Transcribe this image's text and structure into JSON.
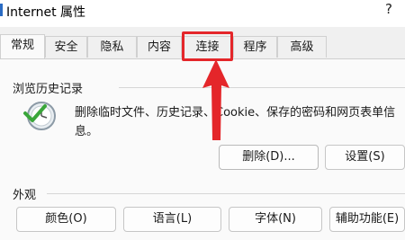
{
  "window": {
    "title": "Internet 属性",
    "help": "?"
  },
  "tabs": [
    {
      "label": "常规",
      "active": true
    },
    {
      "label": "安全"
    },
    {
      "label": "隐私"
    },
    {
      "label": "内容"
    },
    {
      "label": "连接",
      "highlighted": true
    },
    {
      "label": "程序"
    },
    {
      "label": "高级"
    }
  ],
  "history": {
    "heading": "浏览历史记录",
    "description": "删除临时文件、历史记录、Cookie、保存的密码和网页表单信息。",
    "delete_label": "删除(D)...",
    "settings_label": "设置(S)"
  },
  "appearance": {
    "heading": "外观",
    "buttons": [
      "颜色(O)",
      "语言(L)",
      "字体(N)",
      "辅助功能(E)"
    ]
  },
  "colors": {
    "highlight": "#e4262a",
    "icon_green": "#3aa63a"
  }
}
